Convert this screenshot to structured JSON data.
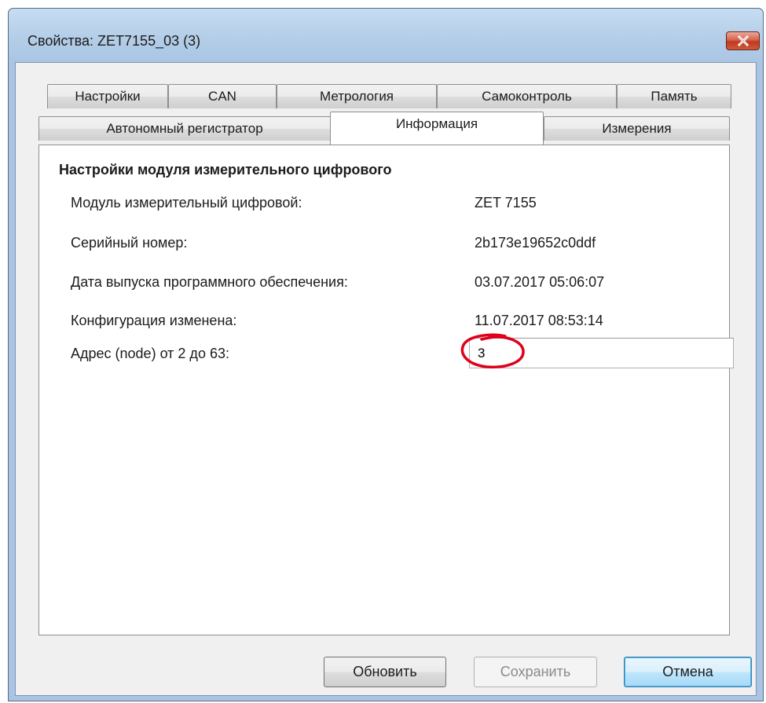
{
  "window": {
    "title": "Свойства: ZET7155_03 (3)",
    "close_icon": "close-x-icon"
  },
  "tabs": {
    "row1": [
      "Настройки",
      "CAN",
      "Метрология",
      "Самоконтроль",
      "Память"
    ],
    "row2": [
      "Автономный регистратор",
      "Информация",
      "Измерения"
    ],
    "active": "Информация"
  },
  "panel": {
    "section_title": "Настройки модуля измерительного цифрового",
    "rows": [
      {
        "label": "Модуль измерительный цифровой:",
        "value": "ZET 7155"
      },
      {
        "label": "Серийный номер:",
        "value": "2b173e19652c0ddf"
      },
      {
        "label": "Дата выпуска программного обеспечения:",
        "value": "03.07.2017 05:06:07"
      },
      {
        "label": "Конфигурация изменена:",
        "value": "11.07.2017 08:53:14"
      }
    ],
    "address": {
      "label": "Адрес (node) от 2 до 63:",
      "value": "3"
    },
    "highlight_color": "#e0001b"
  },
  "buttons": {
    "refresh": "Обновить",
    "save": "Сохранить",
    "cancel": "Отмена"
  }
}
